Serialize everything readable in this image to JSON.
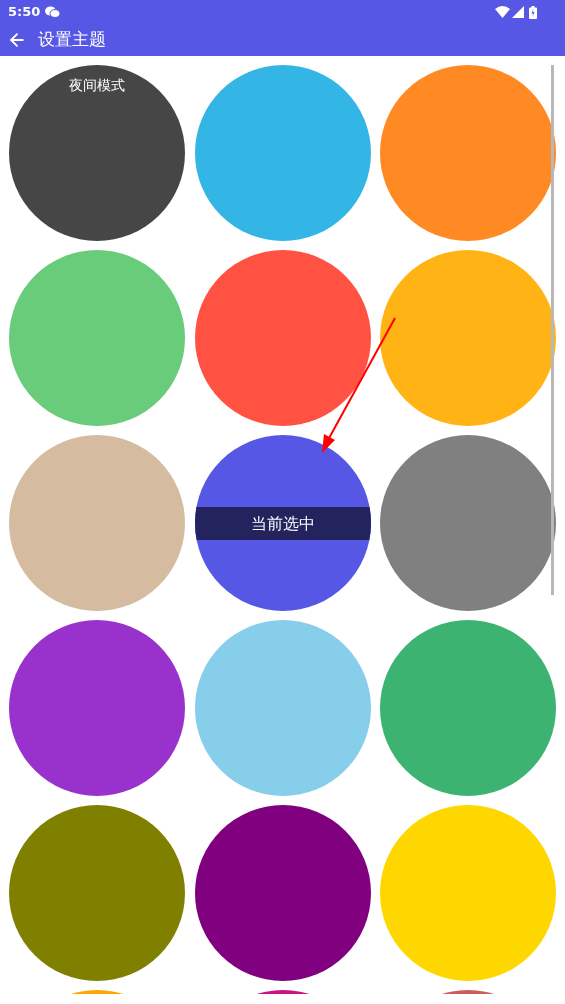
{
  "status_bar": {
    "time": "5:50"
  },
  "app_bar": {
    "title": "设置主题"
  },
  "selected_label": "当前选中",
  "themes": [
    {
      "color": "#464646",
      "selected": false,
      "label": "夜间模式"
    },
    {
      "color": "#33b5e5",
      "selected": false
    },
    {
      "color": "#ff8a24",
      "selected": false
    },
    {
      "color": "#69cc7a",
      "selected": false
    },
    {
      "color": "#ff5242",
      "selected": false
    },
    {
      "color": "#ffb315",
      "selected": false
    },
    {
      "color": "#d5bca1",
      "selected": false
    },
    {
      "color": "#5757e5",
      "selected": true
    },
    {
      "color": "#808080",
      "selected": false
    },
    {
      "color": "#9932cc",
      "selected": false
    },
    {
      "color": "#87ceeb",
      "selected": false
    },
    {
      "color": "#3cb371",
      "selected": false
    },
    {
      "color": "#808000",
      "selected": false
    },
    {
      "color": "#800080",
      "selected": false
    },
    {
      "color": "#ffd700",
      "selected": false
    },
    {
      "color": "#ffa500"
    },
    {
      "color": "#c71585"
    },
    {
      "color": "#cd5c5c"
    }
  ]
}
